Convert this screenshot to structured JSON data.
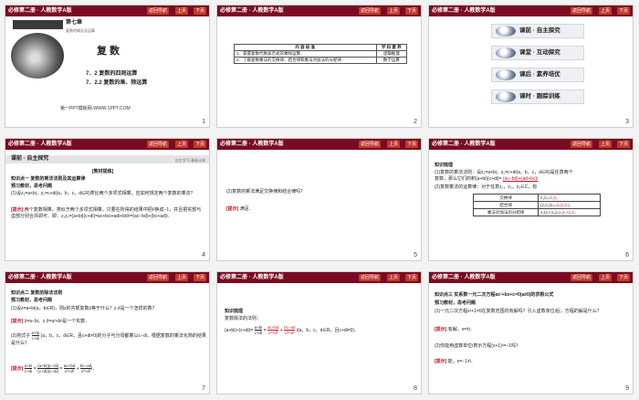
{
  "header": {
    "title": "必修第二册 · 人教数学A版",
    "nav_back": "返回导航",
    "nav_prev": "上页",
    "nav_next": "下页"
  },
  "slides": [
    {
      "number": "1",
      "chapter": "第七章",
      "chapter_sub": "复数的概念及运算",
      "title": "复 数",
      "section1": "7．2   复数的四则运算",
      "section2": "7．2.2   复数的乘、除运算",
      "footer": "第一PPT模板网-WWW.1PPT.COM"
    },
    {
      "number": "2",
      "table_headers": [
        "内 容 标 准",
        "学 科 素 养"
      ],
      "table_rows": [
        [
          "1．掌握复数代数表示式的乘除运算．",
          "逻辑推理"
        ],
        [
          "2．了解复数乘法的交换律、结合律和乘法对加法的分配律．",
          "数学运算"
        ]
      ]
    },
    {
      "number": "3",
      "menu": [
        "课前 · 自主探究",
        "课堂 · 互动探究",
        "课后 · 素养培优",
        "课时 · 跟踪训练"
      ]
    },
    {
      "number": "4",
      "tag": "课前 · 自主探究",
      "tag_right": "自主学习   基础认知",
      "heading": "[教材提炼]",
      "know1": "知识点一  复数的乘法法则及其运算律",
      "pre": "预习教材，思考问题",
      "q1": "(1)设z₁=a+bi，z₂=c+di(a，b，c，d∈R)类比两个多项式相乘，应如何规定两个复数的乘法？",
      "ans_label": "[提示]",
      "a1": "两个复数相乘，类似于两个多项式相乘，只要在所得的结果中把i²换成−1，并且把实部与虚部分别合并即可．即：z₁z₂=(a+bi)(c+di)=ac+bci+adi+bdi²=(ac−bd)+(bc+ad)i．"
    },
    {
      "number": "5",
      "q": "(2)复数的乘法满足交换律和结合律吗？",
      "ans_label": "[提示]",
      "a": "满足．"
    },
    {
      "number": "6",
      "heading": "知识梳理",
      "p1a": "(1)复数的乘法法则：设z₁=a+bi，z₂=c+di(a，b，c，d∈R)是任意两个",
      "p1b": "复数，那么它们的积(a+bi)(c+di)=",
      "p1ans": "(ac−bd)+(ad+bc)i",
      "p2": "(2)复数乘法的运算律：对于任意z₁，z₂，z₃∈C，有",
      "rows": [
        [
          "交换律",
          "z₁z₂=",
          "z₂z₁"
        ],
        [
          "结合律",
          "(z₁z₂)z₃=",
          "z₁(z₂z₃)"
        ],
        [
          "乘法对加法的分配律",
          "z₁(z₂+z₃)=",
          "z₁z₂+z₁z₃"
        ]
      ]
    },
    {
      "number": "7",
      "know": "知识点二  复数的除法法则",
      "pre": "预习教材，思考问题",
      "q1": "(1)设z=a+bi(a，b∈R)，则z的共轭复数z̄等于什么？z·z̄是一个怎样的数？",
      "ans_label": "[提示]",
      "a1": "z̄=a−bi，z·z̄=a²+b²是一个实数．",
      "q2": "(2)将式子",
      "q2_frac_n": "a+bi",
      "q2_frac_d": "c+di",
      "q2_rest": "(a，b，c，d∈R，且c+di≠0)的分子与分母都乘以c−di，根据复数的乘法化简的结果是什么？",
      "a2_label": "[提示]",
      "a2_f1n": "a+bi",
      "a2_f1d": "c+di",
      "a2_f2n": "(a+bi)(c−di)",
      "a2_f2d": "(c+di)(c−di)",
      "a2_f3n": "ac+bd",
      "a2_f3d": "c²+d²",
      "a2_f4n": "bc−ad",
      "a2_f4d": "c²+d²",
      "a2_tail": "i．"
    },
    {
      "number": "8",
      "heading": "知识梳理",
      "p1": "复数除法的法则：",
      "lhs": "(a+bi)÷(c+di)=",
      "f1n": "a+bi",
      "f1d": "c+di",
      "f2n": "ac+bd",
      "f2d": "c²+d²",
      "f3n": "bc−ad",
      "f3d": "c²+d²",
      "tail": "i(a，b，c，d∈R，且c+di≠0)．"
    },
    {
      "number": "9",
      "know": "知识点三  实系数一元二次方程ax²+bx+c=0(a≠0)的求根公式",
      "pre": "预习教材，思考问题",
      "q1": "(1)一元二次方程x²+1=0在复数范围内有解吗？引入虚数单位i后，方程的解是什么？",
      "ans_label": "[提示]",
      "a1": "有解，x=±i．",
      "q2": "(2)你能用虚数单位i表示方程(x+1)²=−1吗？",
      "a2_label": "[提示]",
      "a2": "能，x=−1±i．"
    }
  ]
}
